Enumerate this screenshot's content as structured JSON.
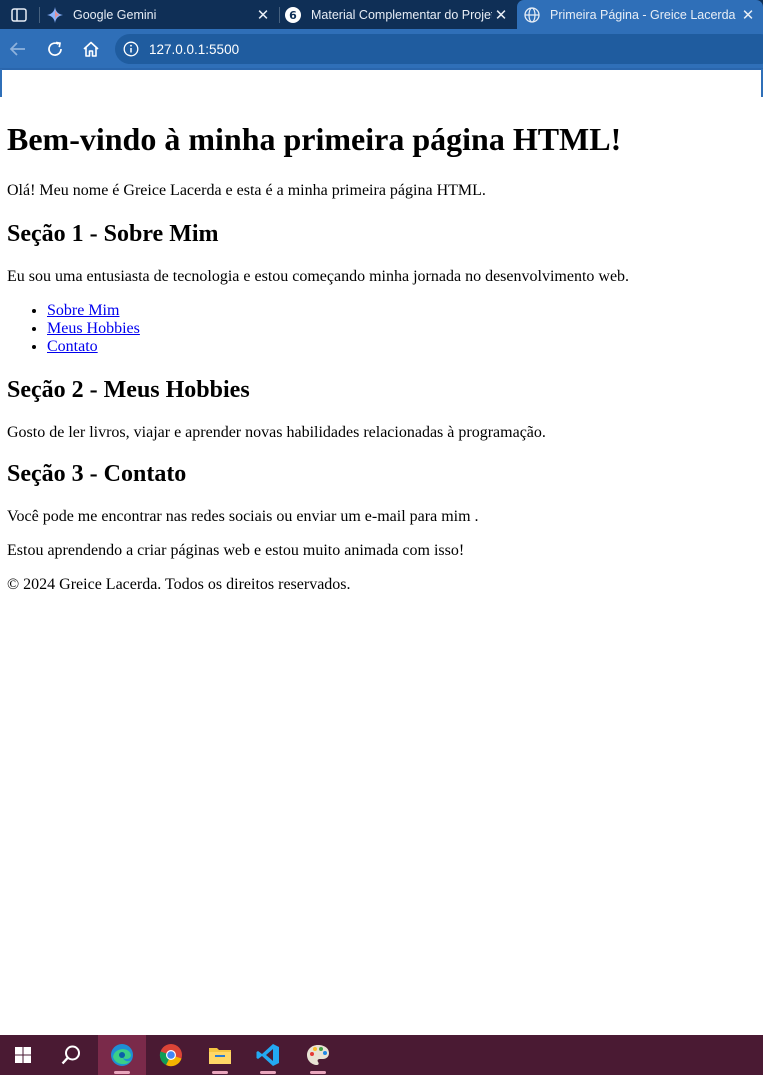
{
  "browser": {
    "tabs": [
      {
        "title": "Google Gemini",
        "favicon": "gemini-icon",
        "close": "✕"
      },
      {
        "title": "Material Complementar do Projeto",
        "favicon": "dio-icon",
        "close": "✕"
      },
      {
        "title": "Primeira Página - Greice Lacerda",
        "favicon": "globe-icon",
        "close": "✕",
        "active": true
      }
    ],
    "address": "127.0.0.1:5500"
  },
  "page": {
    "h1": "Bem-vindo à minha primeira página HTML!",
    "intro": "Olá! Meu nome é Greice Lacerda e esta é a minha primeira página HTML.",
    "section1": {
      "heading": "Seção 1 - Sobre Mim",
      "text": "Eu sou uma entusiasta de tecnologia e estou começando minha jornada no desenvolvimento web.",
      "links": [
        "Sobre Mim",
        "Meus Hobbies",
        "Contato"
      ]
    },
    "section2": {
      "heading": "Seção 2 - Meus Hobbies",
      "text": "Gosto de ler livros, viajar e aprender novas habilidades relacionadas à programação."
    },
    "section3": {
      "heading": "Seção 3 - Contato",
      "text": "Você pode me encontrar nas redes sociais ou enviar um e-mail para mim ."
    },
    "closing": "Estou aprendendo a criar páginas web e estou muito animada com isso!",
    "footer": "© 2024 Greice Lacerda. Todos os direitos reservados."
  },
  "taskbar": {
    "items": [
      "windows-start-icon",
      "search-icon",
      "edge-browser-icon",
      "chrome-icon",
      "file-explorer-icon",
      "vscode-icon",
      "paint-icon"
    ]
  },
  "colors": {
    "tabstrip": "#0f2f56",
    "toolbar": "#2f6fb8",
    "taskbar": "#4a1a33",
    "link": "#0000ee"
  }
}
